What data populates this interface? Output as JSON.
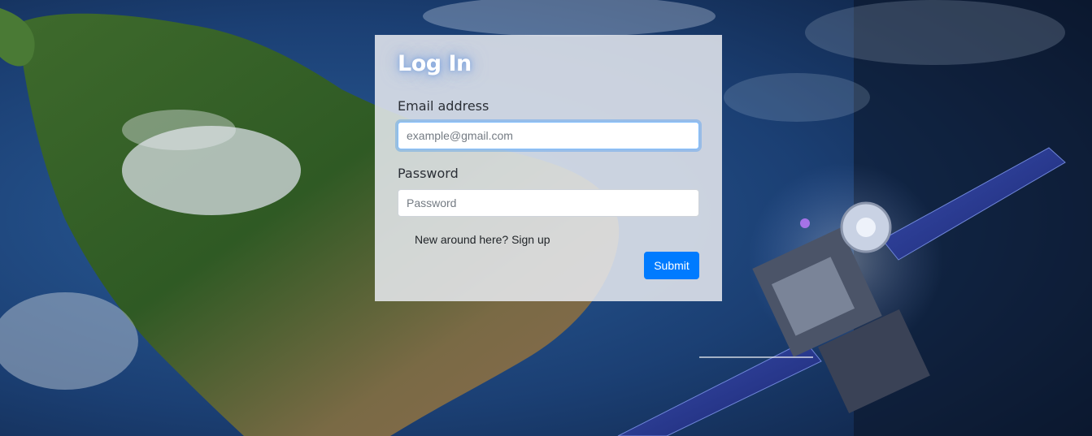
{
  "login": {
    "title": "Log In",
    "email_label": "Email address",
    "email_placeholder": "example@gmail.com",
    "email_value": "",
    "password_label": "Password",
    "password_placeholder": "Password",
    "password_value": "",
    "signup_text": "New around here? Sign up",
    "submit_label": "Submit"
  },
  "colors": {
    "submit_button": "#007bff",
    "focus_ring": "#80bdff",
    "card_background": "#e8eaf0",
    "title_text": "#ffffff"
  },
  "background": {
    "icons": [
      "earth-from-space-image",
      "satellite-image"
    ]
  }
}
